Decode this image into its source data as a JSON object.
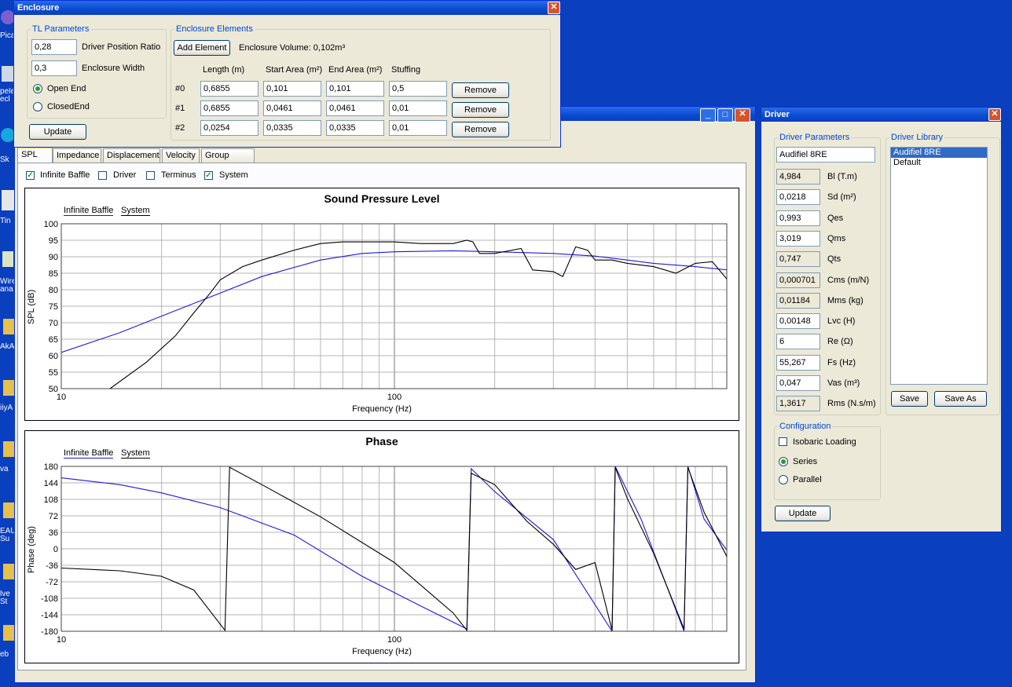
{
  "desktop": {
    "labels": [
      "Pica",
      "pele ecl",
      "Sk",
      "Tin",
      "Wire ana",
      "AkA",
      "iiyA",
      "va",
      "EAU Su",
      "lve St",
      "eb"
    ]
  },
  "enclosure": {
    "title": "Enclosure",
    "tl_legend": "TL Parameters",
    "driver_position_ratio": {
      "value": "0,28",
      "label": "Driver Position Ratio"
    },
    "enclosure_width": {
      "value": "0,3",
      "label": "Enclosure Width"
    },
    "open_end": "Open End",
    "closed_end": "ClosedEnd",
    "update": "Update",
    "elements_legend": "Enclosure Elements",
    "add_element": "Add Element",
    "volume": "Enclosure Volume: 0,102m³",
    "headers": {
      "length": "Length (m)",
      "start_area": "Start Area (m²)",
      "end_area": "End Area (m²)",
      "stuffing": "Stuffing"
    },
    "rows": [
      {
        "id": "#0",
        "length": "0,6855",
        "start": "0,101",
        "end": "0,101",
        "stuffing": "0,5",
        "remove": "Remove"
      },
      {
        "id": "#1",
        "length": "0,6855",
        "start": "0,0461",
        "end": "0,0461",
        "stuffing": "0,01",
        "remove": "Remove"
      },
      {
        "id": "#2",
        "length": "0,0254",
        "start": "0,0335",
        "end": "0,0335",
        "stuffing": "0,01",
        "remove": "Remove"
      }
    ]
  },
  "main": {
    "tabs": [
      "SPL",
      "Impedance",
      "Displacement",
      "Velocity",
      "Group Delay"
    ],
    "checks": {
      "infinite_baffle": "Infinite Baffle",
      "driver": "Driver",
      "terminus": "Terminus",
      "system": "System"
    },
    "spl_title": "Sound Pressure Level",
    "phase_title": "Phase",
    "legend_ib": "Infinite Baffle",
    "legend_sys": "System",
    "xlabel": "Frequency (Hz)",
    "spl_ylabel": "SPL (dB)",
    "phase_ylabel": "Phase (deg)",
    "x_ticks": [
      "10",
      "100"
    ],
    "spl_ticks": [
      "100",
      "95",
      "90",
      "85",
      "80",
      "75",
      "70",
      "65",
      "60",
      "55",
      "50"
    ],
    "phase_ticks": [
      "180",
      "144",
      "108",
      "72",
      "36",
      "0",
      "-36",
      "-72",
      "-108",
      "-144",
      "-180"
    ]
  },
  "driver": {
    "title": "Driver",
    "params_legend": "Driver Parameters",
    "name": "Audifiel 8RE",
    "params": [
      {
        "value": "4,984",
        "label": "Bl (T.m)",
        "ro": true
      },
      {
        "value": "0,0218",
        "label": "Sd (m²)",
        "ro": false
      },
      {
        "value": "0,993",
        "label": "Qes",
        "ro": false
      },
      {
        "value": "3,019",
        "label": "Qms",
        "ro": false
      },
      {
        "value": "0,747",
        "label": "Qts",
        "ro": true
      },
      {
        "value": "0,000701",
        "label": "Cms (m/N)",
        "ro": true
      },
      {
        "value": "0,01184",
        "label": "Mms (kg)",
        "ro": true
      },
      {
        "value": "0,00148",
        "label": "Lvc (H)",
        "ro": false
      },
      {
        "value": "6",
        "label": "Re (Ω)",
        "ro": false
      },
      {
        "value": "55,267",
        "label": "Fs (Hz)",
        "ro": false
      },
      {
        "value": "0,047",
        "label": "Vas (m³)",
        "ro": false
      },
      {
        "value": "1,3617",
        "label": "Rms (N.s/m)",
        "ro": true
      }
    ],
    "library_legend": "Driver Library",
    "library": [
      "Audifiel 8RE",
      "Default"
    ],
    "save": "Save",
    "save_as": "Save As",
    "config_legend": "Configuration",
    "isobaric": "Isobaric Loading",
    "series": "Series",
    "parallel": "Parallel",
    "update": "Update"
  },
  "chart_data": [
    {
      "type": "line",
      "title": "Sound Pressure Level",
      "xlabel": "Frequency (Hz)",
      "ylabel": "SPL (dB)",
      "x_scale": "log",
      "xlim": [
        10,
        200
      ],
      "ylim": [
        50,
        100
      ],
      "grid": true,
      "series": [
        {
          "name": "Infinite Baffle",
          "color": "#1a1adc",
          "x": [
            10,
            15,
            20,
            30,
            40,
            60,
            80,
            100,
            150,
            200,
            300,
            400,
            500,
            600,
            800,
            1000
          ],
          "y": [
            61,
            67,
            72,
            79,
            84,
            89,
            91,
            91.5,
            91.8,
            91.5,
            91,
            90.2,
            89,
            88,
            87,
            86
          ]
        },
        {
          "name": "System",
          "color": "#000000",
          "x": [
            14,
            18,
            22,
            25,
            28,
            30,
            35,
            40,
            50,
            60,
            70,
            80,
            100,
            120,
            150,
            165,
            172,
            180,
            200,
            240,
            260,
            300,
            320,
            350,
            380,
            400,
            450,
            500,
            600,
            700,
            800,
            900,
            1000
          ],
          "y": [
            50,
            58,
            66,
            73,
            79,
            83,
            87,
            89,
            92,
            94,
            94.5,
            94.5,
            94.5,
            94,
            94,
            95,
            94.5,
            91,
            91,
            92.5,
            86,
            85.5,
            84,
            93,
            92,
            89,
            89,
            88,
            87,
            85,
            88,
            88.5,
            83
          ]
        }
      ]
    },
    {
      "type": "line",
      "title": "Phase",
      "xlabel": "Frequency (Hz)",
      "ylabel": "Phase (deg)",
      "x_scale": "log",
      "xlim": [
        10,
        200
      ],
      "ylim": [
        -180,
        180
      ],
      "grid": true,
      "series": [
        {
          "name": "Infinite Baffle",
          "color": "#1a1adc",
          "x": [
            10,
            15,
            20,
            30,
            50,
            80,
            120,
            165,
            170,
            200,
            300,
            450,
            460,
            550,
            740,
            760,
            850,
            1000
          ],
          "y": [
            155,
            140,
            122,
            90,
            30,
            -60,
            -125,
            -175,
            175,
            125,
            20,
            -180,
            180,
            65,
            -180,
            180,
            65,
            -5
          ]
        },
        {
          "name": "System",
          "color": "#000000",
          "x": [
            10,
            15,
            20,
            25,
            31,
            32,
            40,
            60,
            100,
            150,
            165,
            170,
            200,
            250,
            300,
            350,
            400,
            450,
            460,
            500,
            600,
            740,
            760,
            850,
            1000
          ],
          "y": [
            -42,
            -48,
            -60,
            -90,
            -178,
            178,
            140,
            70,
            -30,
            -140,
            -178,
            165,
            140,
            60,
            10,
            -45,
            -30,
            -178,
            178,
            110,
            -10,
            -175,
            178,
            80,
            -20
          ]
        }
      ]
    }
  ]
}
